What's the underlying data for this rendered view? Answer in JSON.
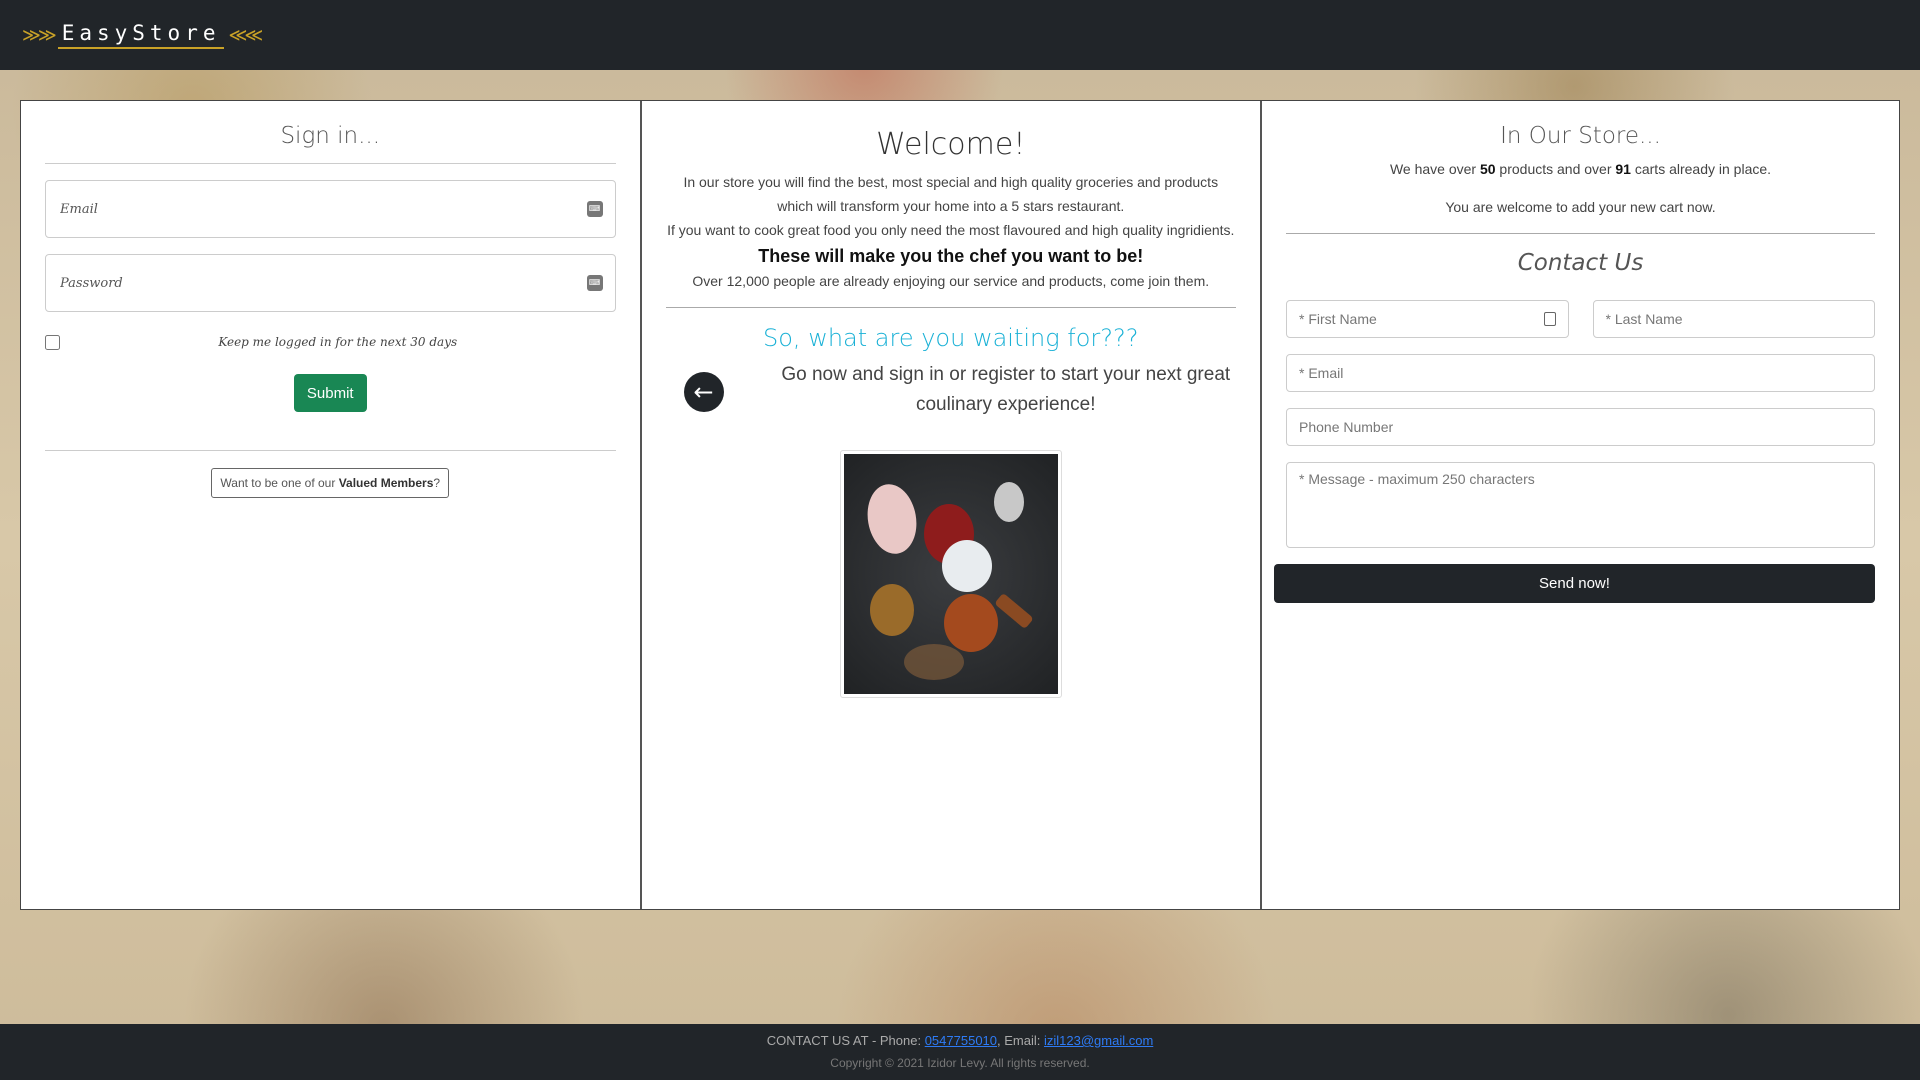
{
  "brand": {
    "name": "EasyStore"
  },
  "signin": {
    "title": "Sign in...",
    "email_placeholder": "Email",
    "password_placeholder": "Password",
    "remember_label": "Keep me logged in for the next 30 days",
    "submit_label": "Submit",
    "register_prefix": "Want to be one of our ",
    "register_link": "Valued Members",
    "register_suffix": "?"
  },
  "welcome": {
    "title": "Welcome!",
    "text1": "In our store you will find the best, most special and high quality groceries and products which will transform your home into a 5 stars restaurant.",
    "text2": "If you want to cook great food you only need the most flavoured and high quality ingridients.",
    "strong": "These will make you the chef you want to be!",
    "text3": "Over 12,000 people are already enjoying our service and products, come join them.",
    "waiting": "So, what are you waiting for???",
    "go_text": "Go now and sign in or register to start your next great coulinary experience!"
  },
  "store": {
    "title": "In Our Store...",
    "line_prefix": "We have over ",
    "products": "50",
    "line_mid": " products and over ",
    "carts": "91",
    "line_suffix": " carts already in place.",
    "line2": "You are welcome to add your new cart now."
  },
  "contact": {
    "title": "Contact Us",
    "first_name_placeholder": "* First Name",
    "last_name_placeholder": "* Last Name",
    "email_placeholder": "* Email",
    "phone_placeholder": "Phone Number",
    "message_placeholder": "* Message - maximum 250 characters",
    "send_label": "Send now!"
  },
  "footer": {
    "prefix": "CONTACT US AT - Phone: ",
    "phone": "0547755010",
    "email_prefix": ", Email: ",
    "email": "izil123@gmail.com",
    "copyright": "Copyright © 2021 Izidor Levy. All rights reserved."
  },
  "icons": {
    "back": "arrow-left-icon",
    "field": "keyboard-icon",
    "person": "person-icon"
  }
}
